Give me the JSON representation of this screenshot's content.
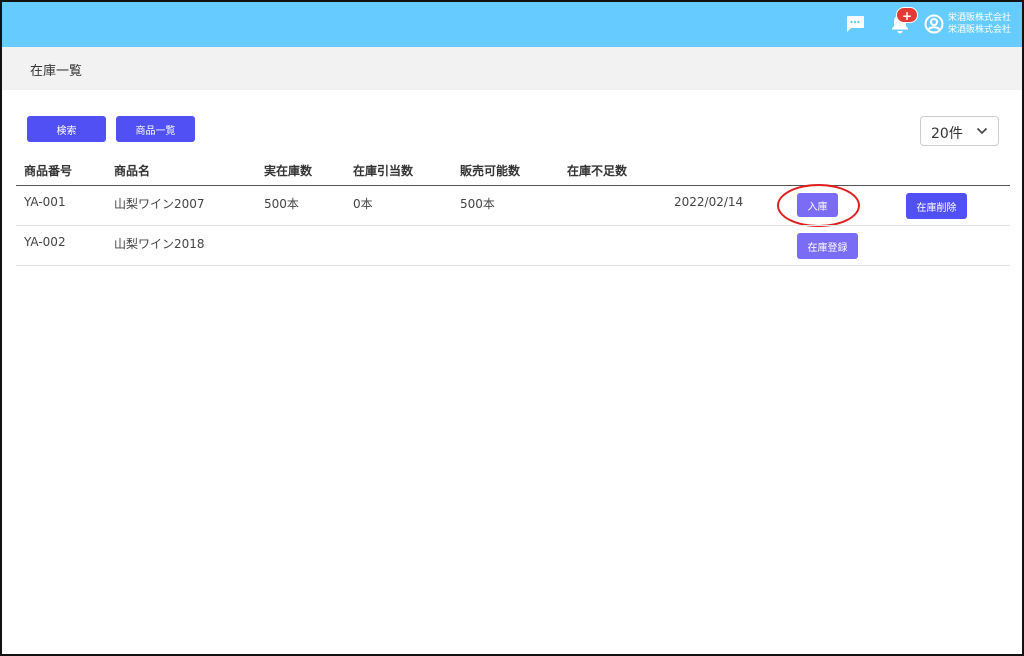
{
  "header": {
    "notification_badge": "+",
    "company_line1": "栄酒販株式会社",
    "company_line2": "栄酒販株式会社",
    "bar_color": "#66ccff"
  },
  "page": {
    "title": "在庫一覧"
  },
  "toolbar": {
    "search_label": "検索",
    "product_list_label": "商品一覧",
    "per_page_value": "20件"
  },
  "table": {
    "columns": [
      "商品番号",
      "商品名",
      "実在庫数",
      "在庫引当数",
      "販売可能数",
      "在庫不足数"
    ],
    "rows": [
      {
        "code": "YA-001",
        "name": "山梨ワイン2007",
        "actual": "500本",
        "allocated": "0本",
        "sellable": "500本",
        "shortage": "",
        "date": "2022/02/14",
        "action_label": "入庫",
        "delete_label": "在庫削除"
      },
      {
        "code": "YA-002",
        "name": "山梨ワイン2018",
        "actual": "",
        "allocated": "",
        "sellable": "",
        "shortage": "",
        "date": "",
        "action_label": "在庫登録"
      }
    ]
  },
  "colors": {
    "primary_button": "#5050f5",
    "secondary_button": "#7b6cf6",
    "highlight_circle": "#e02020"
  },
  "icons": [
    "chat-icon",
    "bell-icon",
    "account-circle-icon",
    "chevron-down-icon"
  ]
}
